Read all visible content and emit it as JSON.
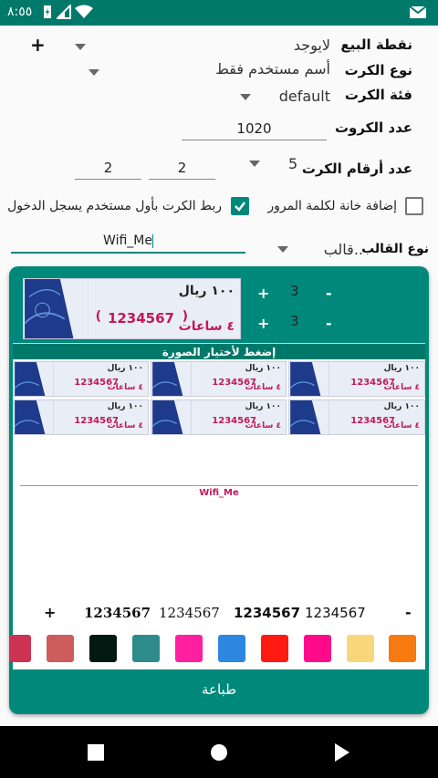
{
  "status": {
    "time": "٨:٥٥"
  },
  "form": {
    "sale_point": {
      "label": "نقطة البيع",
      "value": "لايوجد",
      "add": "+"
    },
    "card_type": {
      "label": "نوع الكرت",
      "value": "أسم مستخدم فقط"
    },
    "card_category": {
      "label": "فئة الكرت",
      "value": "default"
    },
    "card_count": {
      "label": "عدد الكروت",
      "value": "1020"
    },
    "card_digits": {
      "label": "عدد أرقام الكرت",
      "value": "5",
      "input_a": "2",
      "input_b": "2"
    },
    "password_field": {
      "label": "إضافة خانة لكلمة المرور"
    },
    "bind_first_user": {
      "label": "ربط الكرت بأول مستخدم يسجل الدخول"
    },
    "template": {
      "label": "نوع القالب",
      "value": "قالب..",
      "network_name": "Wifi_Me"
    }
  },
  "panel": {
    "card": {
      "price": "١٠٠ ريال",
      "code": "1234567",
      "hours": "٤ ساعات"
    },
    "controls": {
      "plus": "+",
      "minus": "-",
      "num1": "3",
      "num2": "3"
    },
    "choose_image": "إضغط لأختيار الصورة",
    "preview_network": "Wifi_Me",
    "code_samples": {
      "plus": "+",
      "minus": "-",
      "s1": "1234567",
      "s2": "1234567",
      "s3": "1234567",
      "s4": "1234567"
    },
    "swatches": [
      "#cf3354",
      "#cd5c5c",
      "#021911",
      "#2e8b8b",
      "#ff1fa0",
      "#2b87e0",
      "#ff1a12",
      "#ff0a88",
      "#f8d77b",
      "#f67a10"
    ],
    "print": "طباعة"
  }
}
